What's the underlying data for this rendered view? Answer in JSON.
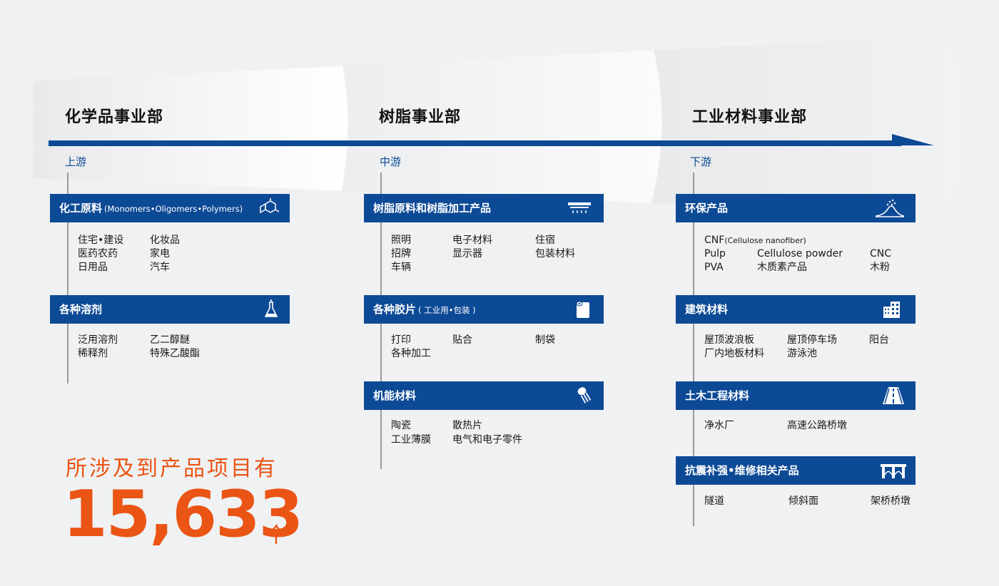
{
  "segments": [
    {
      "title": "化学品事业部",
      "stream": "上游"
    },
    {
      "title": "树脂事业部",
      "stream": "中游"
    },
    {
      "title": "工业材料事业部",
      "stream": "下游"
    }
  ],
  "cards": {
    "monomers": {
      "title": "化工原料",
      "sub": "(Monomers•Oligomers•Polymers)",
      "icon": "molecule-icon",
      "items": [
        "住宅•建设",
        "化妆品",
        "医药农药",
        "家电",
        "日用品",
        "汽车"
      ]
    },
    "solvents": {
      "title": "各种溶剂",
      "icon": "flask-icon",
      "items": [
        "泛用溶剂",
        "乙二醇醚",
        "稀释剂",
        "特殊乙酸酯"
      ]
    },
    "resin": {
      "title": "树脂原料和树脂加工产品",
      "icon": "ceiling-light-icon",
      "items": [
        "照明",
        "电子材料",
        "住宿",
        "招牌",
        "显示器",
        "包装材料",
        "车辆"
      ]
    },
    "films": {
      "title": "各种胶片",
      "sub": "( 工业用•包装 )",
      "icon": "film-roll-icon",
      "items": [
        "打印",
        "贴合",
        "制袋",
        "各种加工"
      ]
    },
    "functional": {
      "title": "机能材料",
      "icon": "electronic-component-icon",
      "items": [
        "陶瓷",
        "散热片",
        "工业薄膜",
        "电气和电子零件"
      ]
    },
    "eco": {
      "title": "环保产品",
      "icon": "powder-pile-icon",
      "cnf_main": "CNF",
      "cnf_sub": "(Cellulose nanofiber)",
      "items": [
        "Pulp",
        "Cellulose powder",
        "CNC",
        "PVA",
        "木质素产品",
        "木粉"
      ]
    },
    "building": {
      "title": "建筑材料",
      "icon": "building-icon",
      "items": [
        "屋顶波浪板",
        "屋顶停车场",
        "阳台",
        "厂内地板材料",
        "游泳池"
      ]
    },
    "civil": {
      "title": "土木工程材料",
      "icon": "highway-icon",
      "items": [
        "净水厂",
        "高速公路桥墩"
      ]
    },
    "seismic": {
      "title": "抗震补强•维修相关产品",
      "icon": "bridge-icon",
      "items": [
        "隧道",
        "倾斜面",
        "架桥桥墩"
      ]
    }
  },
  "total": {
    "label": "所涉及到产品项目有",
    "number": "15,633",
    "unit": "个"
  },
  "colors": {
    "brand_blue": "#0d4a96",
    "accent_orange": "#ea5414"
  }
}
